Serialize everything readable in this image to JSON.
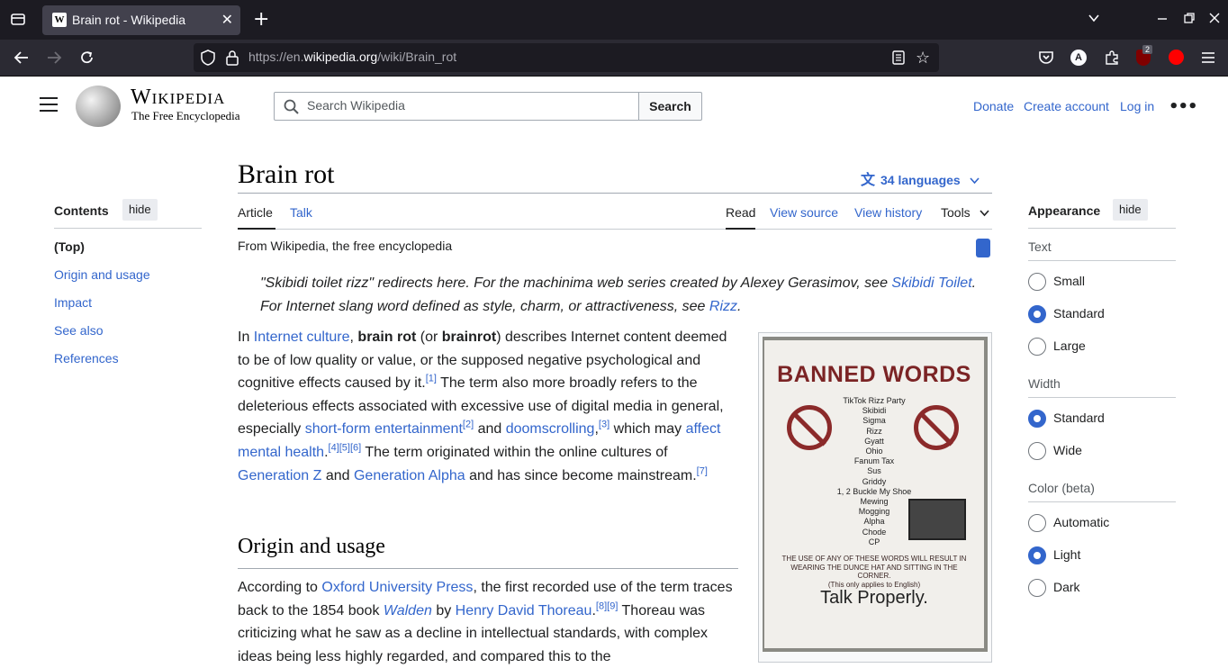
{
  "browser": {
    "tab_title": "Brain rot - Wikipedia",
    "tab_favicon": "W",
    "close_glyph": "✕",
    "new_tab_glyph": "+",
    "url_prefix": "https://en.",
    "url_domain": "wikipedia.org",
    "url_path": "/wiki/Brain_rot",
    "extension_badge": "2"
  },
  "header": {
    "wordmark": "Wikipedia",
    "tagline": "The Free Encyclopedia",
    "search_placeholder": "Search Wikipedia",
    "search_button": "Search",
    "donate": "Donate",
    "create_account": "Create account",
    "login": "Log in",
    "more": "•••"
  },
  "toc": {
    "title": "Contents",
    "hide": "hide",
    "items": [
      "(Top)",
      "Origin and usage",
      "Impact",
      "See also",
      "References"
    ]
  },
  "article": {
    "title": "Brain rot",
    "languages": "34 languages",
    "tabs": [
      "Article",
      "Talk"
    ],
    "actions": [
      "Read",
      "View source",
      "View history",
      "Tools"
    ],
    "from": "From Wikipedia, the free encyclopedia",
    "hatnote": {
      "t1": "\"Skibidi toilet rizz\" redirects here. For the machinima web series created by Alexey Gerasimov, see ",
      "l1": "Skibidi Toilet",
      "t2": ". For Internet slang word defined as style, charm, or attractiveness, see ",
      "l2": "Rizz",
      "t3": "."
    },
    "intro": {
      "s1": "In ",
      "l_internet_culture": "Internet culture",
      "s2": ", ",
      "b_brain_rot": "brain rot",
      "s3": " (or ",
      "b_brainrot": "brainrot",
      "s4": ") describes Internet content deemed to be of low quality or value, or the supposed negative psychological and cognitive effects caused by it.",
      "r1": "[1]",
      "s5": " The term also more broadly refers to the deleterious effects associated with excessive use of digital media in general, especially ",
      "l_short_form": "short-form entertainment",
      "r2": "[2]",
      "s6": " and ",
      "l_doomscrolling": "doomscrolling",
      "s7": ",",
      "r3": "[3]",
      "s8": " which may ",
      "l_mental_health": "affect mental health",
      "s9": ".",
      "r4": "[4]",
      "r5": "[5]",
      "r6": "[6]",
      "s10": " The term originated within the online cultures of ",
      "l_gen_z": "Generation Z",
      "s11": " and ",
      "l_gen_alpha": "Generation Alpha",
      "s12": " and has since become mainstream.",
      "r7": "[7]"
    },
    "section_title": "Origin and usage",
    "origin": {
      "s1": "According to ",
      "l_oup": "Oxford University Press",
      "s2": ", the first recorded use of the term traces back to the 1854 book ",
      "l_walden": "Walden",
      "s3": " by ",
      "l_thoreau": "Henry David Thoreau",
      "s4": ".",
      "r8": "[8]",
      "r9": "[9]",
      "s5": " Thoreau was criticizing what he saw as a decline in intellectual standards, with complex ideas being less highly regarded, and compared this to the"
    }
  },
  "infobox_image": {
    "heading": "BANNED WORDS",
    "words": [
      "TikTok Rizz Party",
      "Skibidi",
      "Sigma",
      "Rizz",
      "Gyatt",
      "Ohio",
      "Fanum Tax",
      "Sus",
      "Griddy",
      "1, 2 Buckle My Shoe",
      "Mewing",
      "Mogging",
      "Alpha",
      "Chode",
      "CP"
    ],
    "warning": "THE USE OF ANY OF THESE WORDS WILL RESULT IN WEARING THE DUNCE HAT AND SITTING IN THE CORNER.",
    "note": "(This only applies to English)",
    "footer": "Talk Properly."
  },
  "appearance": {
    "title": "Appearance",
    "hide": "hide",
    "text_label": "Text",
    "text_options": [
      "Small",
      "Standard",
      "Large"
    ],
    "text_selected": "Standard",
    "width_label": "Width",
    "width_options": [
      "Standard",
      "Wide"
    ],
    "width_selected": "Standard",
    "color_label": "Color (beta)",
    "color_options": [
      "Automatic",
      "Light",
      "Dark"
    ],
    "color_selected": "Light"
  },
  "colors": {
    "link": "#3366cc",
    "text": "#202122",
    "chrome_dark": "#1c1b22"
  }
}
